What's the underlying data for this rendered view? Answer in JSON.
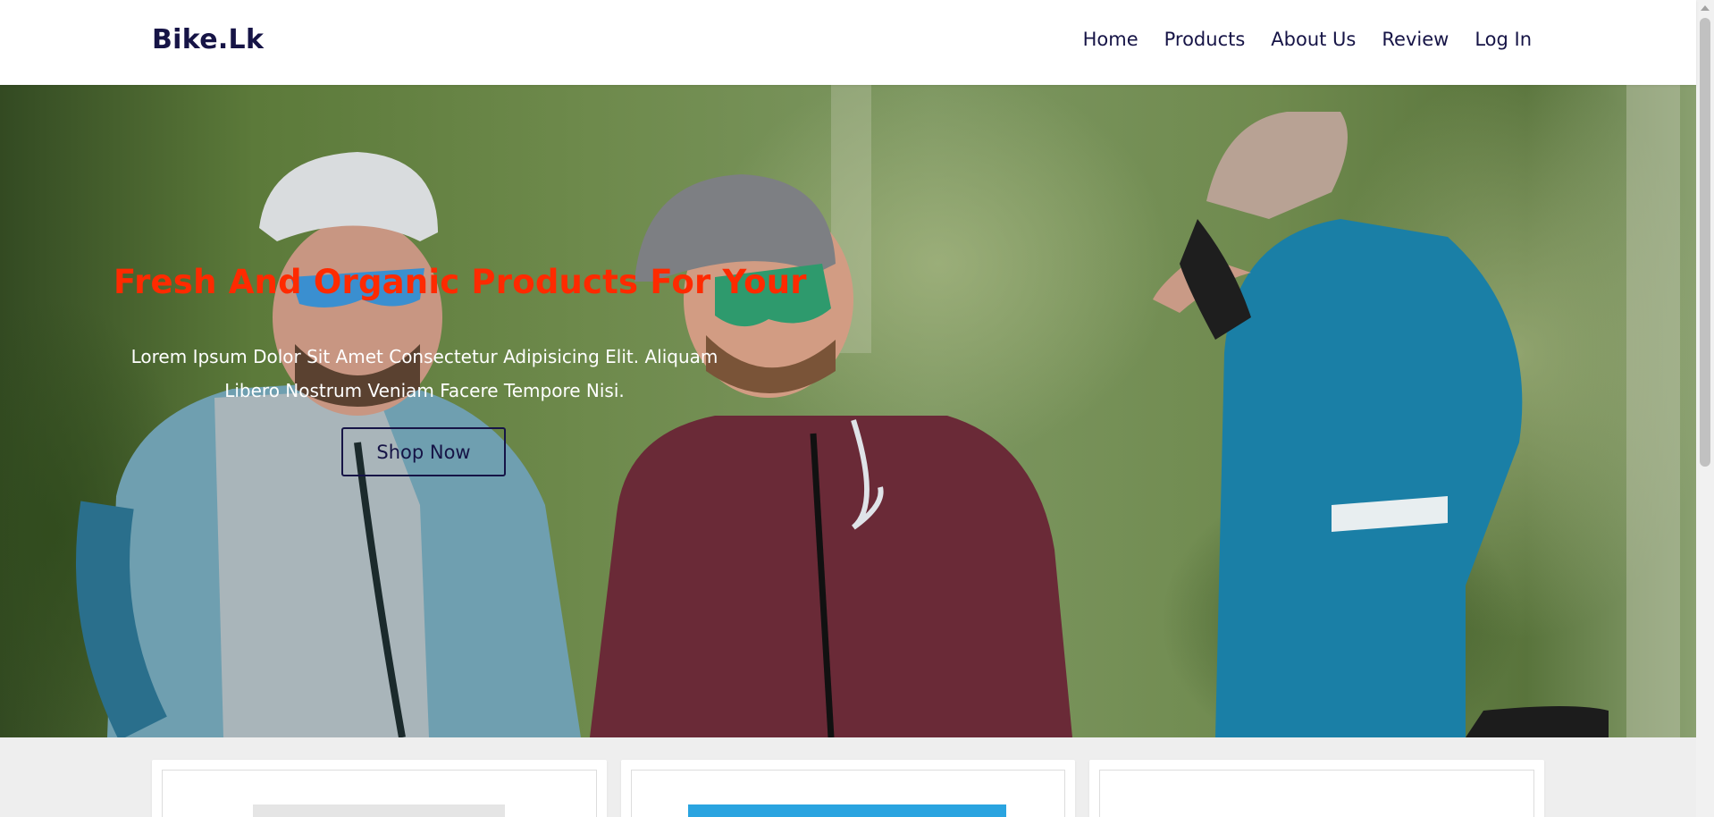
{
  "header": {
    "logo": "Bike.Lk",
    "nav": [
      {
        "label": "Home"
      },
      {
        "label": "Products"
      },
      {
        "label": "About Us"
      },
      {
        "label": "Review"
      },
      {
        "label": "Log In"
      }
    ]
  },
  "hero": {
    "title": "Fresh And Organic Products For Your",
    "description": "Lorem Ipsum Dolor Sit Amet Consectetur Adipisicing Elit. Aliquam Libero Nostrum Veniam Facere Tempore Nisi.",
    "button_label": "Shop Now"
  },
  "colors": {
    "brand": "#161446",
    "accent": "#ff2a00"
  }
}
